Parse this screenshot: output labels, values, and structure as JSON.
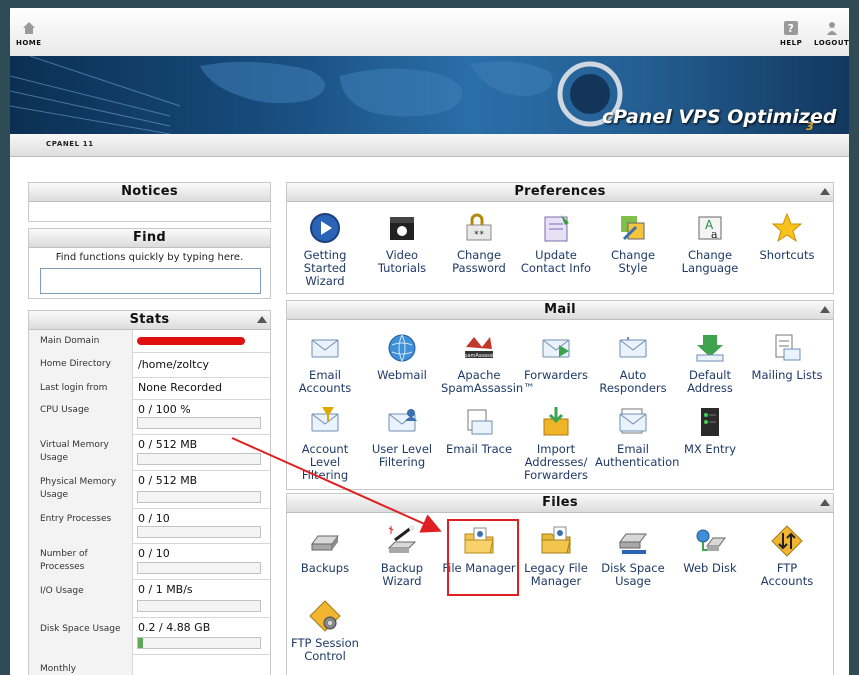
{
  "topbar": {
    "home": "HOME",
    "help": "HELP",
    "logout": "LOGOUT"
  },
  "banner": {
    "logo": "cPanel VPS Optimized",
    "version_mark": "3"
  },
  "breadcrumb": "CPANEL 11",
  "notices": {
    "title": "Notices"
  },
  "find": {
    "title": "Find",
    "hint": "Find functions quickly by typing here.",
    "value": ""
  },
  "stats": {
    "title": "Stats",
    "rows": [
      {
        "label": "Main Domain",
        "value": "",
        "redacted": true
      },
      {
        "label": "Home Directory",
        "value": "/home/zoltcy"
      },
      {
        "label": "Last login from",
        "value": "None Recorded"
      },
      {
        "label": "CPU Usage",
        "value": "0 / 100 %",
        "fill": 0
      },
      {
        "label": "Virtual Memory Usage",
        "value": "0 / 512 MB",
        "fill": 0
      },
      {
        "label": "Physical Memory Usage",
        "value": "0 / 512 MB",
        "fill": 0
      },
      {
        "label": "Entry Processes",
        "value": "0 / 10",
        "fill": 0
      },
      {
        "label": "Number of Processes",
        "value": "0 / 10",
        "fill": 0
      },
      {
        "label": "I/O Usage",
        "value": "0 / 1 MB/s",
        "fill": 0
      },
      {
        "label": "Disk Space Usage",
        "value": "0.2 / 4.88 GB",
        "fill": 0.04
      },
      {
        "label": "Monthly",
        "value": ""
      }
    ]
  },
  "preferences": {
    "title": "Preferences",
    "items": [
      {
        "label": "Getting Started Wizard",
        "icon": "play-circle-icon"
      },
      {
        "label": "Video Tutorials",
        "icon": "clapperboard-icon"
      },
      {
        "label": "Change Password",
        "icon": "password-lock-icon"
      },
      {
        "label": "Update Contact Info",
        "icon": "contact-card-icon"
      },
      {
        "label": "Change Style",
        "icon": "style-palette-icon"
      },
      {
        "label": "Change Language",
        "icon": "language-icon"
      },
      {
        "label": "Shortcuts",
        "icon": "star-icon"
      }
    ]
  },
  "mail": {
    "title": "Mail",
    "items": [
      {
        "label": "Email Accounts",
        "icon": "envelope-icon"
      },
      {
        "label": "Webmail",
        "icon": "globe-icon"
      },
      {
        "label": "Apache SpamAssassin™",
        "icon": "spamassassin-icon"
      },
      {
        "label": "Forwarders",
        "icon": "forward-envelope-icon"
      },
      {
        "label": "Auto Responders",
        "icon": "autoresponder-icon"
      },
      {
        "label": "Default Address",
        "icon": "default-address-icon"
      },
      {
        "label": "Mailing Lists",
        "icon": "mailing-list-icon"
      },
      {
        "label": "Account Level Filtering",
        "icon": "filter-envelope-icon"
      },
      {
        "label": "User Level Filtering",
        "icon": "user-filter-icon"
      },
      {
        "label": "Email Trace",
        "icon": "trace-envelope-icon"
      },
      {
        "label": "Import Addresses/ Forwarders",
        "icon": "import-box-icon"
      },
      {
        "label": "Email Authentication",
        "icon": "auth-envelope-icon"
      },
      {
        "label": "MX Entry",
        "icon": "server-icon"
      }
    ]
  },
  "files": {
    "title": "Files",
    "items": [
      {
        "label": "Backups",
        "icon": "disk-drive-icon"
      },
      {
        "label": "Backup Wizard",
        "icon": "wizard-wand-icon"
      },
      {
        "label": "File Manager",
        "icon": "folder-icon"
      },
      {
        "label": "Legacy File Manager",
        "icon": "legacy-folder-icon"
      },
      {
        "label": "Disk Space Usage",
        "icon": "disk-usage-icon"
      },
      {
        "label": "Web Disk",
        "icon": "web-disk-icon"
      },
      {
        "label": "FTP Accounts",
        "icon": "ftp-arrows-icon"
      },
      {
        "label": "FTP Session Control",
        "icon": "ftp-gear-icon"
      }
    ]
  },
  "colors": {
    "background": "#2f4b56",
    "link": "#1e3a66",
    "highlight": "#e02020",
    "annotation_arrow": "#e02020"
  }
}
